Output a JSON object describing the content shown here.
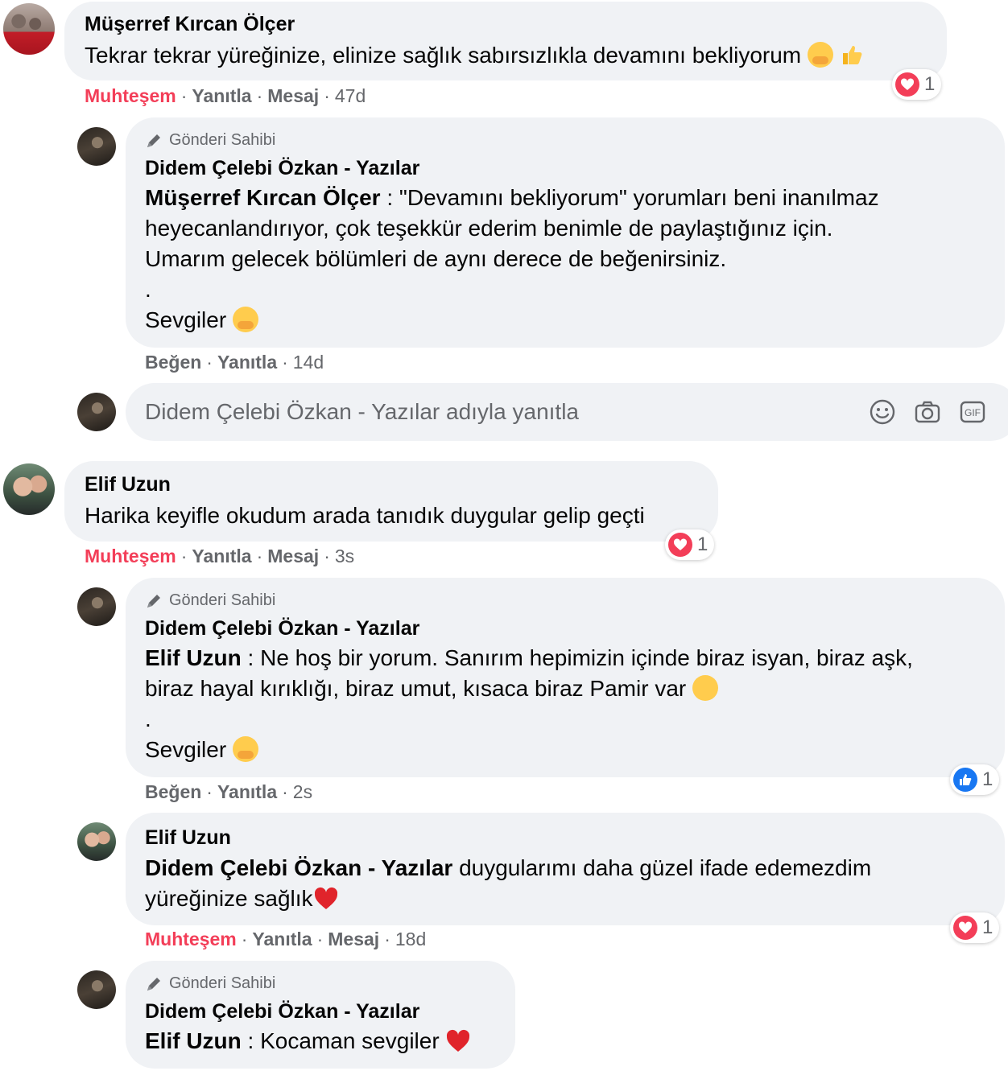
{
  "comment1": {
    "author": "Müşerref Kırcan Ölçer",
    "text": "Tekrar tekrar yüreğinize, elinize sağlık sabırsızlıkla devamını bekliyorum",
    "reaction_label": "Muhteşem",
    "reply_label": "Yanıtla",
    "message_label": "Mesaj",
    "time": "47d",
    "reaction_count": "1"
  },
  "reply1": {
    "badge": "Gönderi Sahibi",
    "author": "Didem Çelebi Özkan - Yazılar",
    "mention": "Müşerref Kırcan Ölçer",
    "sep": " : ",
    "line1": "\"Devamını bekliyorum\" yorumları beni inanılmaz",
    "line2": "heyecanlandırıyor, çok teşekkür ederim benimle de paylaştığınız için.",
    "line3": "Umarım gelecek bölümleri de aynı derece de beğenirsiniz.",
    "dot": ".",
    "signoff": "Sevgiler",
    "like_label": "Beğen",
    "reply_label": "Yanıtla",
    "time": "14d"
  },
  "reply_box": {
    "placeholder": "Didem Çelebi Özkan - Yazılar adıyla yanıtla",
    "icons": [
      "smiley-icon",
      "camera-icon",
      "gif-icon"
    ]
  },
  "comment2": {
    "author": "Elif Uzun",
    "text": "Harika keyifle okudum arada tanıdık duygular gelip geçti",
    "reaction_label": "Muhteşem",
    "reply_label": "Yanıtla",
    "message_label": "Mesaj",
    "time": "3s",
    "reaction_count": "1"
  },
  "reply2": {
    "badge": "Gönderi Sahibi",
    "author": "Didem Çelebi Özkan - Yazılar",
    "mention": "Elif Uzun",
    "sep": " : ",
    "line1": "Ne hoş bir yorum. Sanırım hepimizin içinde biraz isyan, biraz aşk,",
    "line2": "biraz hayal kırıklığı, biraz umut, kısaca biraz Pamir var",
    "dot": ".",
    "signoff": "Sevgiler",
    "like_label": "Beğen",
    "reply_label": "Yanıtla",
    "time": "2s",
    "reaction_count": "1"
  },
  "reply3": {
    "author": "Elif Uzun",
    "mention": "Didem Çelebi Özkan - Yazılar",
    "line1": " duygularımı daha güzel ifade edemezdim",
    "line2": "yüreğinize sağlık",
    "reaction_label": "Muhteşem",
    "reply_label": "Yanıtla",
    "message_label": "Mesaj",
    "time": "18d",
    "reaction_count": "1"
  },
  "reply4": {
    "badge": "Gönderi Sahibi",
    "author": "Didem Çelebi Özkan - Yazılar",
    "mention": "Elif Uzun",
    "sep": " : ",
    "text": "Kocaman sevgiler"
  },
  "colors": {
    "bubble": "#f0f2f5",
    "muhtesem": "#f33e58",
    "secondary_text": "#65676b",
    "like_blue": "#1877f2"
  }
}
